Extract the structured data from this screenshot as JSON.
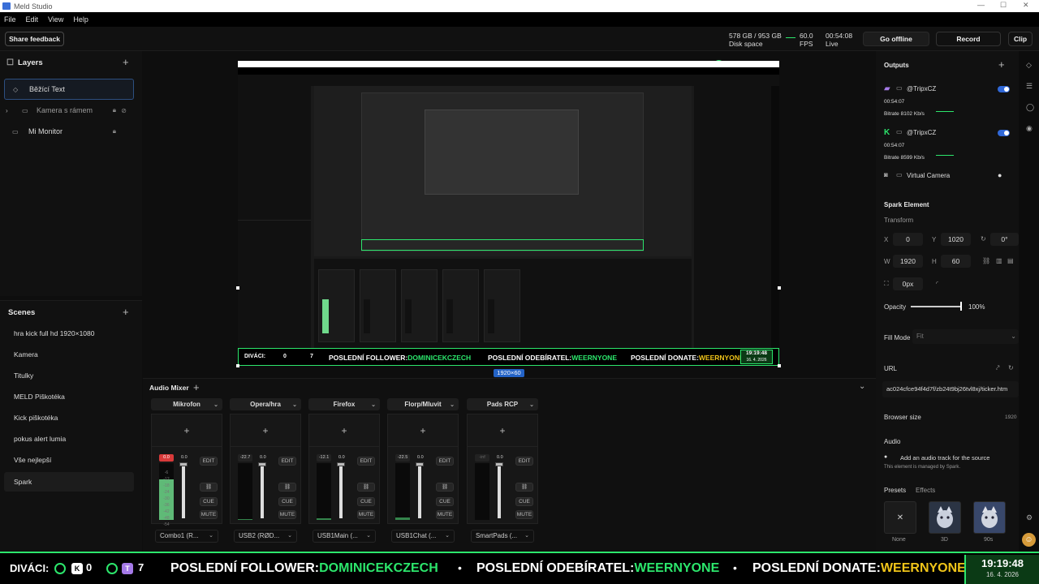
{
  "window": {
    "title": "Meld Studio"
  },
  "menu": [
    "File",
    "Edit",
    "View",
    "Help"
  ],
  "toolbar": {
    "share_feedback": "Share feedback",
    "disk_used": "578 GB / 953 GB",
    "disk_label": "Disk space",
    "fps_value": "60.0",
    "fps_label": "FPS",
    "live_time": "00:54:08",
    "live_label": "Live",
    "go_offline": "Go offline",
    "record": "Record",
    "clip": "Clip"
  },
  "layers": {
    "title": "Layers",
    "items": [
      {
        "label": "Běžící Text",
        "icon": "diamond-icon"
      },
      {
        "label": "Kamera s rámem",
        "icon": "folder-icon"
      },
      {
        "label": "Mi Monitor",
        "icon": "monitor-icon"
      }
    ]
  },
  "scenes": {
    "title": "Scenes",
    "items": [
      "hra kick full hd 1920×1080",
      "Kamera",
      "Titulky",
      "MELD Piškotéka",
      "Kick piškotéka",
      "pokus alert lumia",
      "Vše nejlepší",
      "Spark"
    ]
  },
  "preview": {
    "dims_badge": "1920×60",
    "ticker_viewers": "DIVÁCI:",
    "ticker_kick_count": "0",
    "ticker_twitch_count": "7",
    "ticker_follower_label": "POSLEDNÍ FOLLOWER:",
    "ticker_follower": "DOMINICEKCZECH",
    "ticker_sub_label": "POSLEDNÍ ODEBÍRATEL:",
    "ticker_sub": "WEERNYONE",
    "ticker_donate_label": "POSLEDNÍ DONATE:",
    "ticker_donate": "WEERNYONE",
    "clock_time": "19:19:48",
    "clock_date": "16. 4. 2026"
  },
  "mixer": {
    "title": "Audio Mixer",
    "channels": [
      {
        "name": "Mikrofon",
        "db_left": "0.0",
        "db_right": "0.0",
        "source": "Combo1 (R...",
        "level": 0.72,
        "peak": true
      },
      {
        "name": "Opera/hra",
        "db_left": "-22.7",
        "db_right": "0.0",
        "source": "USB2 (RØD...",
        "level": 0.02,
        "peak": false
      },
      {
        "name": "Firefox",
        "db_left": "-12.1",
        "db_right": "0.0",
        "source": "USB1Main (...",
        "level": 0.03,
        "peak": false
      },
      {
        "name": "Florp/Mluvit",
        "db_left": "-22.5",
        "db_right": "0.0",
        "source": "USB1Chat (...",
        "level": 0.05,
        "peak": false
      },
      {
        "name": "Pads RCP",
        "db_left": "-inf",
        "db_right": "0.0",
        "source": "SmartPads (...",
        "level": 0.0,
        "peak": false
      }
    ],
    "meter_marks": [
      "-6",
      "-12",
      "-18",
      "-24",
      "-30",
      "-36",
      "-42",
      "-48",
      "-54"
    ],
    "edit": "EDIT",
    "cue": "CUE",
    "mute": "MUTE"
  },
  "outputs": {
    "title": "Outputs",
    "items": [
      {
        "platform": "twitch-icon",
        "name": "@TripxCZ",
        "time": "00:54:07",
        "bitrate": "Bitrate   8102 Kb/s",
        "enabled": true
      },
      {
        "platform": "kick-icon",
        "name": "@TripxCZ",
        "time": "00:54:07",
        "bitrate": "Bitrate   8599 Kb/s",
        "enabled": true
      }
    ],
    "virtual_camera": "Virtual Camera"
  },
  "element": {
    "title": "Spark Element",
    "transform_label": "Transform",
    "x_label": "X",
    "x": "0",
    "y_label": "Y",
    "y": "1020",
    "rot": "0°",
    "w_label": "W",
    "w": "1920",
    "h_label": "H",
    "h": "60",
    "corner": "0px",
    "opacity_label": "Opacity",
    "opacity": "100%",
    "opacity_value": 1.0,
    "fill_mode_label": "Fill Mode",
    "fill_mode": "Fit",
    "url_label": "URL",
    "url": "ac024cfce94f4d7f/zb24t9bj26tvl8xj/ticker.htm",
    "browser_size_label": "Browser size",
    "browser_size": "1920",
    "audio_label": "Audio",
    "audio_option": "Add an audio track for the source",
    "managed_note": "This element is managed by Spark.",
    "presets_tab": "Presets",
    "effects_tab": "Effects",
    "presets": [
      "None",
      "3D",
      "90s"
    ]
  },
  "ticker": {
    "viewers": "DIVÁCI:",
    "kick_count": "0",
    "twitch_count": "7",
    "kick_letter": "K",
    "twitch_letter": "T",
    "follower_label": "POSLEDNÍ FOLLOWER:",
    "follower": "DOMINICEKCZECH",
    "sub_label": "POSLEDNÍ ODEBÍRATEL:",
    "sub": "WEERNYONE",
    "donate_label": "POSLEDNÍ DONATE:",
    "donate": "WEERNYONE",
    "bullet": "•",
    "time": "19:19:48",
    "date": "16. 4. 2026"
  },
  "colors": {
    "accent": "#2ce66c",
    "blue": "#3068d8",
    "donate": "#f0c419",
    "twitch": "#a57ae8"
  }
}
